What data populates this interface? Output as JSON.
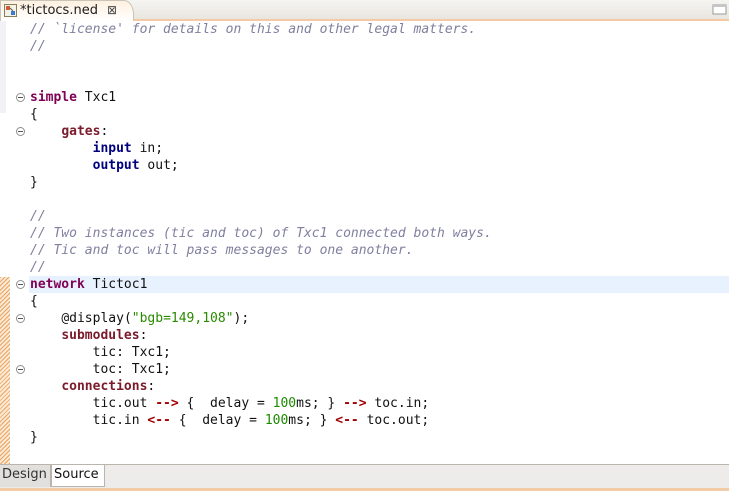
{
  "editor_tab": {
    "title": "*tictocs.ned",
    "icon": "ned-file-icon",
    "close_glyph": "⊠"
  },
  "code_lines": [
    [
      {
        "t": "// `license' for details on this and other legal matters.",
        "c": "c"
      }
    ],
    [
      {
        "t": "//",
        "c": "c"
      }
    ],
    [],
    [],
    [
      {
        "t": "simple",
        "c": "k"
      },
      {
        "t": " Txc1",
        "c": "t"
      }
    ],
    [
      {
        "t": "{",
        "c": "t"
      }
    ],
    [
      {
        "t": "    ",
        "c": "t"
      },
      {
        "t": "gates",
        "c": "g"
      },
      {
        "t": ":",
        "c": "t"
      }
    ],
    [
      {
        "t": "        ",
        "c": "t"
      },
      {
        "t": "input",
        "c": "d"
      },
      {
        "t": " in;",
        "c": "t"
      }
    ],
    [
      {
        "t": "        ",
        "c": "t"
      },
      {
        "t": "output",
        "c": "d"
      },
      {
        "t": " out;",
        "c": "t"
      }
    ],
    [
      {
        "t": "}",
        "c": "t"
      }
    ],
    [],
    [
      {
        "t": "//",
        "c": "c"
      }
    ],
    [
      {
        "t": "// Two instances (tic and toc) of Txc1 connected both ways.",
        "c": "c"
      }
    ],
    [
      {
        "t": "// Tic and toc will pass messages to one another.",
        "c": "c"
      }
    ],
    [
      {
        "t": "//",
        "c": "c"
      }
    ],
    [
      {
        "t": "network",
        "c": "k"
      },
      {
        "t": " Tictoc1",
        "c": "t"
      }
    ],
    [
      {
        "t": "{",
        "c": "t"
      }
    ],
    [
      {
        "t": "    ",
        "c": "t"
      },
      {
        "t": "@display",
        "c": "t"
      },
      {
        "t": "(",
        "c": "t"
      },
      {
        "t": "\"bgb=149,108\"",
        "c": "s"
      },
      {
        "t": ");",
        "c": "t"
      }
    ],
    [
      {
        "t": "    ",
        "c": "t"
      },
      {
        "t": "submodules",
        "c": "g"
      },
      {
        "t": ":",
        "c": "t"
      }
    ],
    [
      {
        "t": "        tic: Txc1;",
        "c": "t"
      }
    ],
    [
      {
        "t": "        toc: Txc1;",
        "c": "t"
      }
    ],
    [
      {
        "t": "    ",
        "c": "t"
      },
      {
        "t": "connections",
        "c": "g"
      },
      {
        "t": ":",
        "c": "t"
      }
    ],
    [
      {
        "t": "        tic.out ",
        "c": "t"
      },
      {
        "t": "-->",
        "c": "a"
      },
      {
        "t": " {  delay = ",
        "c": "t"
      },
      {
        "t": "100",
        "c": "n"
      },
      {
        "t": "ms; } ",
        "c": "t"
      },
      {
        "t": "-->",
        "c": "a"
      },
      {
        "t": " toc.in;",
        "c": "t"
      }
    ],
    [
      {
        "t": "        tic.in ",
        "c": "t"
      },
      {
        "t": "<--",
        "c": "a"
      },
      {
        "t": " {  delay = ",
        "c": "t"
      },
      {
        "t": "100",
        "c": "n"
      },
      {
        "t": "ms; } ",
        "c": "t"
      },
      {
        "t": "<--",
        "c": "a"
      },
      {
        "t": " toc.out;",
        "c": "t"
      }
    ],
    [
      {
        "t": "}",
        "c": "t"
      }
    ]
  ],
  "current_line_index": 15,
  "fold_markers_at_lines": [
    4,
    6,
    15,
    17,
    20
  ],
  "bottom_tabs": [
    {
      "label": "Design",
      "selected": false
    },
    {
      "label": "Source",
      "selected": true
    }
  ],
  "colors": {
    "comment": "#7f7f9f",
    "keyword": "#7f0055",
    "string": "#2a8a00",
    "current_line": "#e8f2fe",
    "tab_accent": "#f5c8a6"
  }
}
